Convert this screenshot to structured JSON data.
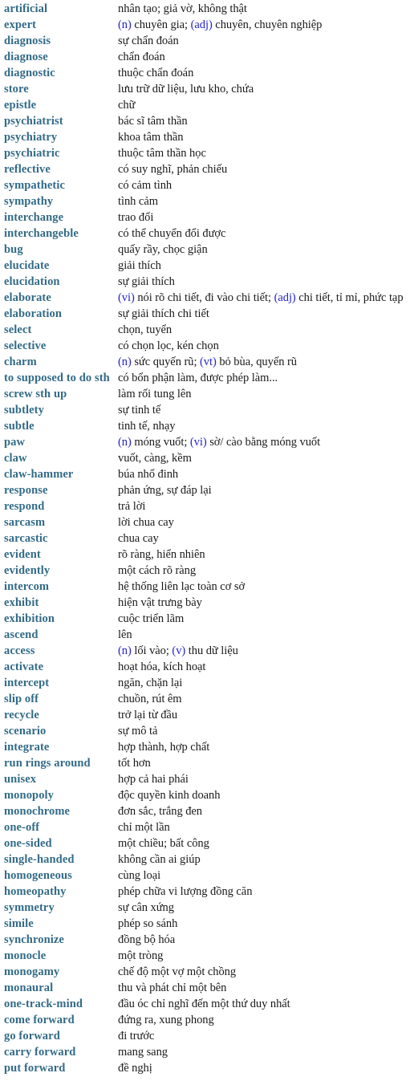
{
  "page": {
    "kind": "vocabulary-glossary",
    "source_language": "English",
    "target_language": "Vietnamese",
    "background_color": "#ffffff",
    "term_color": "#336b87",
    "definition_color": "#1a1a1a",
    "pos_marker_color": "#2424c8",
    "row_count": 67
  },
  "entries": [
    {
      "term": "artificial",
      "definition": "nhân tạo; giả vờ, không thật"
    },
    {
      "term": "expert",
      "definition": "<span class=\"pos\" data-name=\"pos-marker\" data-interactable=\"false\">(n)</span> chuyên gia; <span class=\"pos\" data-name=\"pos-marker\" data-interactable=\"false\">(adj)</span> chuyên, chuyên nghiệp",
      "html": true
    },
    {
      "term": "diagnosis",
      "definition": "sự chẩn đoán"
    },
    {
      "term": "diagnose",
      "definition": "chẩn đoán"
    },
    {
      "term": "diagnostic",
      "definition": "thuộc chẩn đoán"
    },
    {
      "term": "store",
      "definition": "lưu trữ dữ liệu, lưu kho, chứa"
    },
    {
      "term": "epistle",
      "definition": "chữ"
    },
    {
      "term": "psychiatrist",
      "definition": "bác sĩ tâm thần"
    },
    {
      "term": "psychiatry",
      "definition": "khoa tâm thần"
    },
    {
      "term": "psychiatric",
      "definition": "thuộc tâm thần học"
    },
    {
      "term": "reflective",
      "definition": "có suy nghĩ, phản chiếu"
    },
    {
      "term": "sympathetic",
      "definition": "có cảm tình"
    },
    {
      "term": "sympathy",
      "definition": "tình cảm"
    },
    {
      "term": "interchange",
      "definition": "trao đổi"
    },
    {
      "term": "interchangeble",
      "definition": "có thể chuyển đổi được"
    },
    {
      "term": "bug",
      "definition": "quấy rầy, chọc giận"
    },
    {
      "term": "elucidate",
      "definition": "giải thích"
    },
    {
      "term": "elucidation",
      "definition": "sự giải thích"
    },
    {
      "term": "elaborate",
      "definition": "<span class=\"pos\" data-name=\"pos-marker\" data-interactable=\"false\">(vi)</span> nói rõ chi tiết, đi vào chi tiết; <span class=\"pos\" data-name=\"pos-marker\" data-interactable=\"false\">(adj)</span> chi tiết, tỉ mỉ, phức tạp",
      "html": true
    },
    {
      "term": "elaboration",
      "definition": "sự giải thích chi tiết"
    },
    {
      "term": "select",
      "definition": "chọn, tuyển"
    },
    {
      "term": "selective",
      "definition": "có chọn lọc, kén chọn"
    },
    {
      "term": "charm",
      "definition": "<span class=\"pos\" data-name=\"pos-marker\" data-interactable=\"false\">(n)</span> sức quyến rũ; <span class=\"pos\" data-name=\"pos-marker\" data-interactable=\"false\">(vt)</span> bỏ bùa, quyến rũ",
      "html": true
    },
    {
      "term": "to supposed to do sth",
      "definition": "có bổn phận làm, được phép làm..."
    },
    {
      "term": "screw sth up",
      "definition": "làm rối tung lên"
    },
    {
      "term": "subtlety",
      "definition": "sự tinh tế"
    },
    {
      "term": "subtle",
      "definition": "tinh tế, nhạy"
    },
    {
      "term": "paw",
      "definition": "<span class=\"pos\" data-name=\"pos-marker\" data-interactable=\"false\">(n)</span> móng vuốt; <span class=\"pos\" data-name=\"pos-marker\" data-interactable=\"false\">(vi)</span> sờ/ cào bằng móng vuốt",
      "html": true
    },
    {
      "term": "claw",
      "definition": "vuốt, càng, kềm"
    },
    {
      "term": "claw-hammer",
      "definition": "búa nhổ đinh"
    },
    {
      "term": "response",
      "definition": "phản ứng, sự đáp lại"
    },
    {
      "term": "respond",
      "definition": "trả lời"
    },
    {
      "term": "sarcasm",
      "definition": "lời chua cay"
    },
    {
      "term": "sarcastic",
      "definition": "chua cay"
    },
    {
      "term": "evident",
      "definition": "rõ ràng, hiển nhiên"
    },
    {
      "term": "evidently",
      "definition": "một cách rõ ràng"
    },
    {
      "term": "intercom",
      "definition": "hệ thống liên lạc toàn cơ sở"
    },
    {
      "term": "exhibit",
      "definition": "hiện vật trưng bày"
    },
    {
      "term": "exhibition",
      "definition": "cuộc triển lãm"
    },
    {
      "term": "ascend",
      "definition": "lên"
    },
    {
      "term": "access",
      "definition": "<span class=\"pos\" data-name=\"pos-marker\" data-interactable=\"false\">(n)</span> lối vào; <span class=\"pos\" data-name=\"pos-marker\" data-interactable=\"false\">(v)</span> thu dữ liệu",
      "html": true
    },
    {
      "term": "activate",
      "definition": "hoạt hóa, kích hoạt"
    },
    {
      "term": "intercept",
      "definition": "ngăn, chặn lại"
    },
    {
      "term": "slip off",
      "definition": "chuồn, rút êm"
    },
    {
      "term": "recycle",
      "definition": "trở lại từ đầu"
    },
    {
      "term": "scenario",
      "definition": "sự mô tả"
    },
    {
      "term": "integrate",
      "definition": "hợp thành, hợp chất"
    },
    {
      "term": "run rings around",
      "definition": "tốt hơn"
    },
    {
      "term": "unisex",
      "definition": "hợp cả hai phái"
    },
    {
      "term": "monopoly",
      "definition": "độc quyền kinh doanh"
    },
    {
      "term": "monochrome",
      "definition": "đơn sắc, trắng đen"
    },
    {
      "term": "one-off",
      "definition": "chỉ một lần"
    },
    {
      "term": "one-sided",
      "definition": "một chiều; bất công"
    },
    {
      "term": "single-handed",
      "definition": "không cần ai giúp"
    },
    {
      "term": "homogeneous",
      "definition": "cùng loại"
    },
    {
      "term": "homeopathy",
      "definition": "phép chữa vi lượng đồng căn"
    },
    {
      "term": "symmetry",
      "definition": "sự cân xứng"
    },
    {
      "term": "simile",
      "definition": "phép so sánh"
    },
    {
      "term": "synchronize",
      "definition": "đồng bộ hóa"
    },
    {
      "term": "monocle",
      "definition": "một tròng"
    },
    {
      "term": "monogamy",
      "definition": "chế độ một vợ một chồng"
    },
    {
      "term": "monaural",
      "definition": "thu và phát chỉ một bên"
    },
    {
      "term": "one-track-mind",
      "definition": "đầu óc chỉ nghĩ đến một thứ duy nhất"
    },
    {
      "term": "come forward",
      "definition": "đứng ra, xung phong"
    },
    {
      "term": "go forward",
      "definition": "đi trước"
    },
    {
      "term": "carry forward",
      "definition": "mang sang"
    },
    {
      "term": "put forward",
      "definition": "đề nghị"
    }
  ]
}
